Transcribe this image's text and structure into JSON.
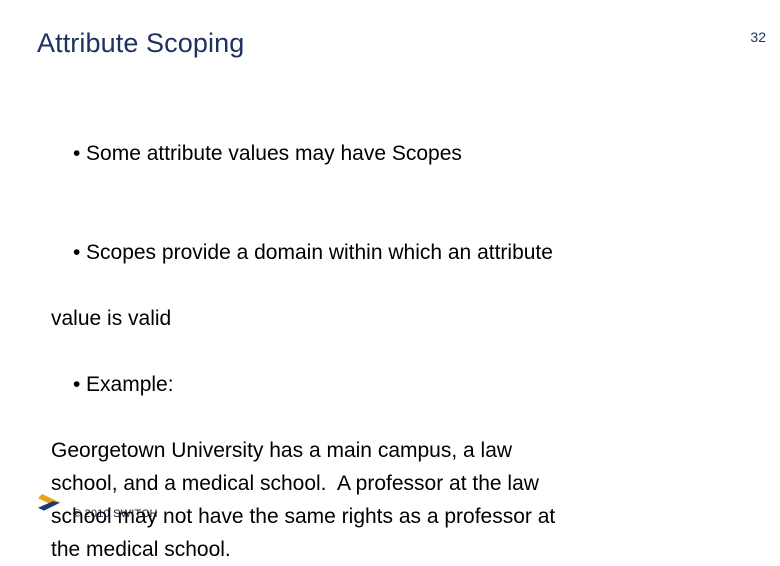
{
  "slide": {
    "title": "Attribute Scoping",
    "number": "32",
    "title_color": "#1f3160",
    "background_color": "#ffffff",
    "body_text_color": "#000000"
  },
  "body": {
    "bullets": [
      {
        "marker": "•",
        "lines": [
          "Some attribute values may have Scopes"
        ]
      },
      {
        "marker": "•",
        "lines": [
          "Scopes provide a domain within which an attribute",
          "value is valid"
        ]
      },
      {
        "marker": "•",
        "lines": [
          "Example:"
        ]
      }
    ],
    "example_paragraph": [
      "Georgetown University has a main campus, a law",
      "school, and a medical school.  A professor at the law",
      "school may not have the same rights as a professor at",
      "the medical school."
    ]
  },
  "footer": {
    "copyright": "© 2010 SWITCH",
    "logo_name": "switch-chevron-logo",
    "logo_gold": "#e8a317",
    "logo_navy": "#1f3a6e"
  }
}
